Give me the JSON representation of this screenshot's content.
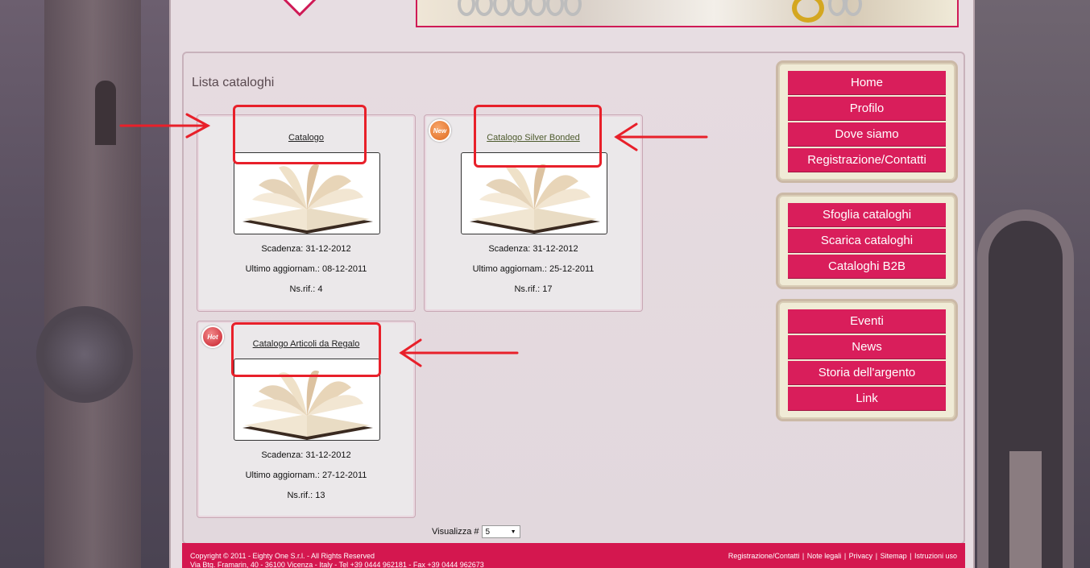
{
  "page_title": "Lista cataloghi",
  "catalogs": [
    {
      "title": "Catalogo",
      "badge": "",
      "scadenza": "Scadenza: 31-12-2012",
      "aggiornamento": "Ultimo aggiornam.: 08-12-2011",
      "rif": "Ns.rif.: 4"
    },
    {
      "title": "Catalogo Silver Bonded",
      "badge": "New",
      "scadenza": "Scadenza: 31-12-2012",
      "aggiornamento": "Ultimo aggiornam.: 25-12-2011",
      "rif": "Ns.rif.: 17"
    },
    {
      "title": "Catalogo Articoli da Regalo",
      "badge": "Hot",
      "scadenza": "Scadenza: 31-12-2012",
      "aggiornamento": "Ultimo aggiornam.: 27-12-2011",
      "rif": "Ns.rif.: 13"
    }
  ],
  "menu1": [
    "Home",
    "Profilo",
    "Dove siamo",
    "Registrazione/Contatti"
  ],
  "menu2": [
    "Sfoglia cataloghi",
    "Scarica cataloghi",
    "Cataloghi B2B"
  ],
  "menu3": [
    "Eventi",
    "News",
    "Storia dell'argento",
    "Link"
  ],
  "pager": {
    "label": "Visualizza #",
    "value": "5"
  },
  "footer": {
    "copyright": "Copyright © 2011 - Eighty One S.r.l. - All Rights Reserved",
    "address": "Via Btg. Framarin, 40 - 36100 Vicenza - Italy - Tel +39 0444 962181 - Fax +39 0444 962673",
    "links": [
      "Registrazione/Contatti",
      "Note legali",
      "Privacy",
      "Sitemap",
      "Istruzioni uso"
    ]
  },
  "colors": {
    "accent": "#d91e5b",
    "annotation": "#e8202a"
  }
}
